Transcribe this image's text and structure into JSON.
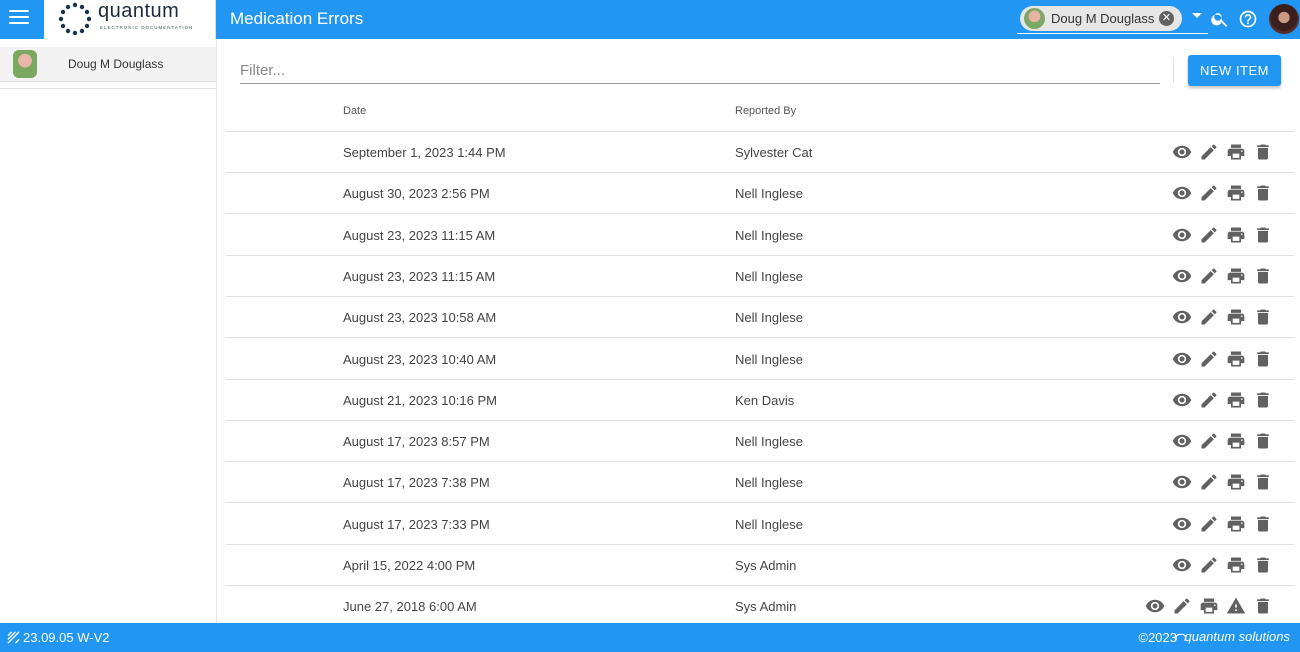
{
  "app": {
    "logo_text": "quantum",
    "logo_subtitle": "ELECTRONIC DOCUMENTATION",
    "page_title": "Medication Errors"
  },
  "header": {
    "patient_chip_name": "Doug M Douglass",
    "icons": [
      "menu-icon",
      "chevron-down-icon",
      "search-icon",
      "help-icon",
      "user-avatar"
    ]
  },
  "sidebar": {
    "items": [
      {
        "label": "Doug M Douglass"
      }
    ]
  },
  "main": {
    "filter_placeholder": "Filter...",
    "new_item_label": "NEW ITEM",
    "columns": [
      "Date",
      "Reported By"
    ],
    "rows": [
      {
        "date": "September 1, 2023 1:44 PM",
        "reported_by": "Sylvester Cat",
        "actions": [
          "view",
          "edit",
          "print",
          "delete"
        ]
      },
      {
        "date": "August 30, 2023 2:56 PM",
        "reported_by": "Nell Inglese",
        "actions": [
          "view",
          "edit",
          "print",
          "delete"
        ]
      },
      {
        "date": "August 23, 2023 11:15 AM",
        "reported_by": "Nell Inglese",
        "actions": [
          "view",
          "edit",
          "print",
          "delete"
        ]
      },
      {
        "date": "August 23, 2023 11:15 AM",
        "reported_by": "Nell Inglese",
        "actions": [
          "view",
          "edit",
          "print",
          "delete"
        ]
      },
      {
        "date": "August 23, 2023 10:58 AM",
        "reported_by": "Nell Inglese",
        "actions": [
          "view",
          "edit",
          "print",
          "delete"
        ]
      },
      {
        "date": "August 23, 2023 10:40 AM",
        "reported_by": "Nell Inglese",
        "actions": [
          "view",
          "edit",
          "print",
          "delete"
        ]
      },
      {
        "date": "August 21, 2023 10:16 PM",
        "reported_by": "Ken Davis",
        "actions": [
          "view",
          "edit",
          "print",
          "delete"
        ]
      },
      {
        "date": "August 17, 2023 8:57 PM",
        "reported_by": "Nell Inglese",
        "actions": [
          "view",
          "edit",
          "print",
          "delete"
        ]
      },
      {
        "date": "August 17, 2023 7:38 PM",
        "reported_by": "Nell Inglese",
        "actions": [
          "view",
          "edit",
          "print",
          "delete"
        ]
      },
      {
        "date": "August 17, 2023 7:33 PM",
        "reported_by": "Nell Inglese",
        "actions": [
          "view",
          "edit",
          "print",
          "delete"
        ]
      },
      {
        "date": "April 15, 2022 4:00 PM",
        "reported_by": "Sys Admin",
        "actions": [
          "view",
          "edit",
          "print",
          "delete"
        ]
      },
      {
        "date": "June 27, 2018 6:00 AM",
        "reported_by": "Sys Admin",
        "actions": [
          "view",
          "edit",
          "print",
          "warning",
          "delete"
        ]
      }
    ]
  },
  "footer": {
    "version": "23.09.05 W-V2",
    "copyright": "©2023",
    "brand": "quantum solutions"
  },
  "colors": {
    "primary": "#2196f3",
    "icon_gray": "#616161"
  }
}
